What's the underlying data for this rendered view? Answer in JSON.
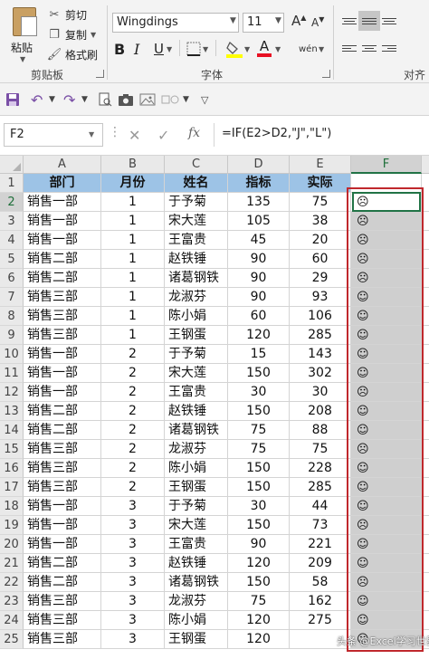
{
  "ribbon": {
    "clipboard": {
      "paste_label": "粘贴",
      "cut_label": "剪切",
      "copy_label": "复制",
      "format_painter_label": "格式刷",
      "group_label": "剪贴板"
    },
    "font": {
      "font_name": "Wingdings",
      "font_size": "11",
      "grow_glyph": "A",
      "shrink_glyph": "A",
      "bold": "B",
      "italic": "I",
      "underline": "U",
      "font_color_glyph": "A",
      "phonetic_glyph": "wén",
      "group_label": "字体"
    },
    "alignment": {
      "group_label": "对齐"
    }
  },
  "formula_bar": {
    "name_box": "F2",
    "fx": "fx",
    "formula": "=IF(E2>D2,\"J\",\"L\")"
  },
  "sheet": {
    "columns": [
      "A",
      "B",
      "C",
      "D",
      "E",
      "F"
    ],
    "headers": [
      "部门",
      "月份",
      "姓名",
      "指标",
      "实际"
    ],
    "rows": [
      {
        "num": "2",
        "dept": "销售一部",
        "month": "1",
        "name": "于予菊",
        "target": "135",
        "actual": "75",
        "face": "☹"
      },
      {
        "num": "3",
        "dept": "销售一部",
        "month": "1",
        "name": "宋大莲",
        "target": "105",
        "actual": "38",
        "face": "☹"
      },
      {
        "num": "4",
        "dept": "销售一部",
        "month": "1",
        "name": "王富贵",
        "target": "45",
        "actual": "20",
        "face": "☹"
      },
      {
        "num": "5",
        "dept": "销售二部",
        "month": "1",
        "name": "赵铁锤",
        "target": "90",
        "actual": "60",
        "face": "☹"
      },
      {
        "num": "6",
        "dept": "销售二部",
        "month": "1",
        "name": "诸葛钢铁",
        "target": "90",
        "actual": "29",
        "face": "☹"
      },
      {
        "num": "7",
        "dept": "销售三部",
        "month": "1",
        "name": "龙淑芬",
        "target": "90",
        "actual": "93",
        "face": "☺"
      },
      {
        "num": "8",
        "dept": "销售三部",
        "month": "1",
        "name": "陈小娟",
        "target": "60",
        "actual": "106",
        "face": "☺"
      },
      {
        "num": "9",
        "dept": "销售三部",
        "month": "1",
        "name": "王钢蛋",
        "target": "120",
        "actual": "285",
        "face": "☺"
      },
      {
        "num": "10",
        "dept": "销售一部",
        "month": "2",
        "name": "于予菊",
        "target": "15",
        "actual": "143",
        "face": "☺"
      },
      {
        "num": "11",
        "dept": "销售一部",
        "month": "2",
        "name": "宋大莲",
        "target": "150",
        "actual": "302",
        "face": "☺"
      },
      {
        "num": "12",
        "dept": "销售一部",
        "month": "2",
        "name": "王富贵",
        "target": "30",
        "actual": "30",
        "face": "☹"
      },
      {
        "num": "13",
        "dept": "销售二部",
        "month": "2",
        "name": "赵铁锤",
        "target": "150",
        "actual": "208",
        "face": "☺"
      },
      {
        "num": "14",
        "dept": "销售二部",
        "month": "2",
        "name": "诸葛钢铁",
        "target": "75",
        "actual": "88",
        "face": "☺"
      },
      {
        "num": "15",
        "dept": "销售三部",
        "month": "2",
        "name": "龙淑芬",
        "target": "75",
        "actual": "75",
        "face": "☹"
      },
      {
        "num": "16",
        "dept": "销售三部",
        "month": "2",
        "name": "陈小娟",
        "target": "150",
        "actual": "228",
        "face": "☺"
      },
      {
        "num": "17",
        "dept": "销售三部",
        "month": "2",
        "name": "王钢蛋",
        "target": "150",
        "actual": "285",
        "face": "☺"
      },
      {
        "num": "18",
        "dept": "销售一部",
        "month": "3",
        "name": "于予菊",
        "target": "30",
        "actual": "44",
        "face": "☺"
      },
      {
        "num": "19",
        "dept": "销售一部",
        "month": "3",
        "name": "宋大莲",
        "target": "150",
        "actual": "73",
        "face": "☹"
      },
      {
        "num": "20",
        "dept": "销售一部",
        "month": "3",
        "name": "王富贵",
        "target": "90",
        "actual": "221",
        "face": "☺"
      },
      {
        "num": "21",
        "dept": "销售二部",
        "month": "3",
        "name": "赵铁锤",
        "target": "120",
        "actual": "209",
        "face": "☺"
      },
      {
        "num": "22",
        "dept": "销售二部",
        "month": "3",
        "name": "诸葛钢铁",
        "target": "150",
        "actual": "58",
        "face": "☹"
      },
      {
        "num": "23",
        "dept": "销售三部",
        "month": "3",
        "name": "龙淑芬",
        "target": "75",
        "actual": "162",
        "face": "☺"
      },
      {
        "num": "24",
        "dept": "销售三部",
        "month": "3",
        "name": "陈小娟",
        "target": "120",
        "actual": "275",
        "face": "☺"
      },
      {
        "num": "25",
        "dept": "销售三部",
        "month": "3",
        "name": "王钢蛋",
        "target": "120",
        "actual": "",
        "face": "☺"
      }
    ]
  },
  "watermark": "头条 @Excel学习世界",
  "colors": {
    "header_fill": "#9dc3e6",
    "highlight_border": "#c0282d",
    "active_border": "#217346",
    "formula_column_fill": "#cfcfcf"
  }
}
